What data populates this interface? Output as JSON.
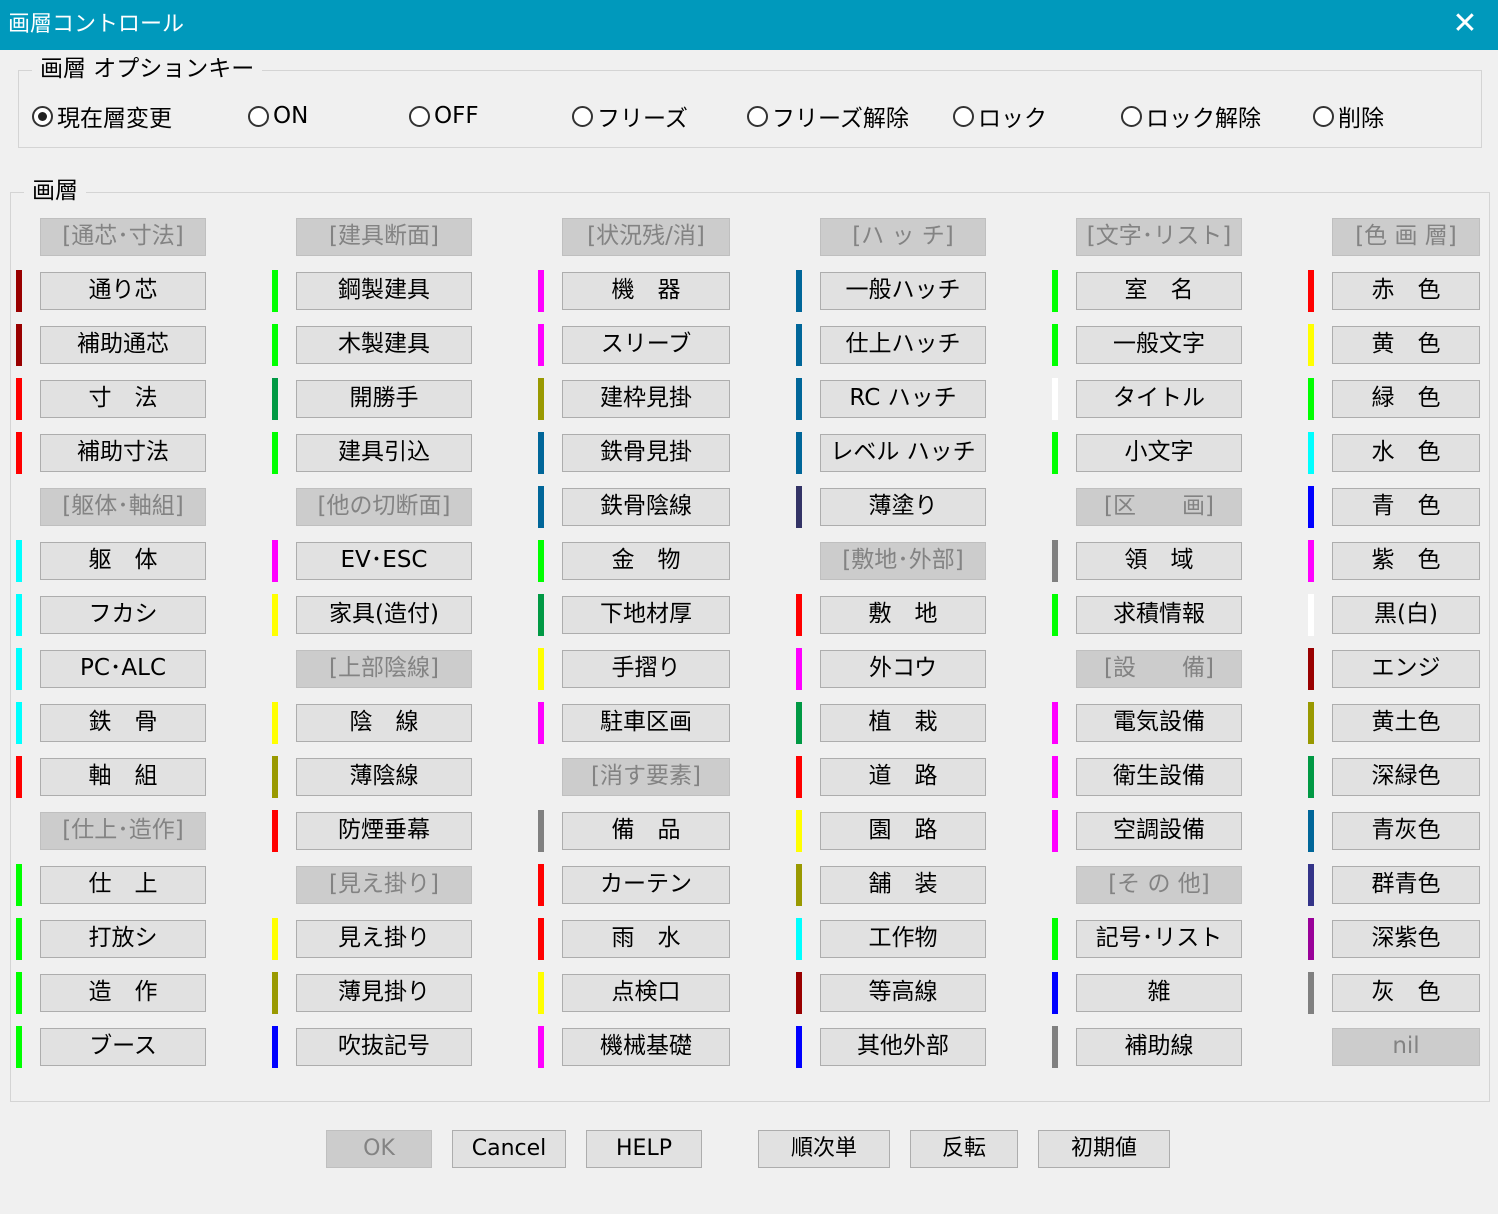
{
  "window": {
    "title": "画層コントロール",
    "close_glyph": "✕"
  },
  "options": {
    "legend": "画層 オプションキー",
    "selected": 0,
    "items": [
      "現在層変更",
      "ON",
      "OFF",
      "フリーズ",
      "フリーズ解除",
      "ロック",
      "ロック解除",
      "削除"
    ]
  },
  "layers": {
    "legend": "画層",
    "columns": [
      [
        {
          "label": "[通芯･寸法]",
          "cat": true
        },
        {
          "label": "通り芯",
          "color": "#990000"
        },
        {
          "label": "補助通芯",
          "color": "#990000"
        },
        {
          "label": "寸　法",
          "color": "#ff0000"
        },
        {
          "label": "補助寸法",
          "color": "#ff0000"
        },
        {
          "label": "[躯体･軸組]",
          "cat": true
        },
        {
          "label": "躯　体",
          "color": "#00ffff"
        },
        {
          "label": "フカシ",
          "color": "#00ffff"
        },
        {
          "label": "PC･ALC",
          "color": "#00ffff"
        },
        {
          "label": "鉄　骨",
          "color": "#00ffff"
        },
        {
          "label": "軸　組",
          "color": "#ff0000"
        },
        {
          "label": "[仕上･造作]",
          "cat": true
        },
        {
          "label": "仕　上",
          "color": "#00ff00"
        },
        {
          "label": "打放シ",
          "color": "#00ff00"
        },
        {
          "label": "造　作",
          "color": "#00ff00"
        },
        {
          "label": "ブース",
          "color": "#00ff00"
        }
      ],
      [
        {
          "label": "[建具断面]",
          "cat": true
        },
        {
          "label": "鋼製建具",
          "color": "#00ff00"
        },
        {
          "label": "木製建具",
          "color": "#00ff00"
        },
        {
          "label": "開勝手",
          "color": "#009944"
        },
        {
          "label": "建具引込",
          "color": "#00ff00"
        },
        {
          "label": "[他の切断面]",
          "cat": true
        },
        {
          "label": "EV･ESC",
          "color": "#ff00ff"
        },
        {
          "label": "家具(造付)",
          "color": "#ffff00"
        },
        {
          "label": "[上部陰線]",
          "cat": true
        },
        {
          "label": "陰　線",
          "color": "#ffff00"
        },
        {
          "label": "薄陰線",
          "color": "#999900"
        },
        {
          "label": "防煙垂幕",
          "color": "#ff0000"
        },
        {
          "label": "[見え掛り]",
          "cat": true
        },
        {
          "label": "見え掛り",
          "color": "#ffff00"
        },
        {
          "label": "薄見掛り",
          "color": "#999900"
        },
        {
          "label": "吹抜記号",
          "color": "#0000ff"
        }
      ],
      [
        {
          "label": "[状況残/消]",
          "cat": true
        },
        {
          "label": "機　器",
          "color": "#ff00ff"
        },
        {
          "label": "スリーブ",
          "color": "#ff00ff"
        },
        {
          "label": "建枠見掛",
          "color": "#999900"
        },
        {
          "label": "鉄骨見掛",
          "color": "#006699"
        },
        {
          "label": "鉄骨陰線",
          "color": "#006699"
        },
        {
          "label": "金　物",
          "color": "#00ff00"
        },
        {
          "label": "下地材厚",
          "color": "#009944"
        },
        {
          "label": "手摺り",
          "color": "#ffff00"
        },
        {
          "label": "駐車区画",
          "color": "#ff00ff"
        },
        {
          "label": "[消す要素]",
          "cat": true
        },
        {
          "label": "備　品",
          "color": "#808080"
        },
        {
          "label": "カーテン",
          "color": "#ff0000"
        },
        {
          "label": "雨　水",
          "color": "#ff0000"
        },
        {
          "label": "点検口",
          "color": "#ffff00"
        },
        {
          "label": "機械基礎",
          "color": "#ff00ff"
        }
      ],
      [
        {
          "label": "[ハ ッ チ]",
          "cat": true
        },
        {
          "label": "一般ハッチ",
          "color": "#006699"
        },
        {
          "label": "仕上ハッチ",
          "color": "#006699"
        },
        {
          "label": "RC ハッチ",
          "color": "#006699"
        },
        {
          "label": "レベル ハッチ",
          "color": "#006699"
        },
        {
          "label": "薄塗り",
          "color": "#333366"
        },
        {
          "label": "[敷地･外部]",
          "cat": true
        },
        {
          "label": "敷　地",
          "color": "#ff0000"
        },
        {
          "label": "外コウ",
          "color": "#ff00ff"
        },
        {
          "label": "植　栽",
          "color": "#009944"
        },
        {
          "label": "道　路",
          "color": "#ff0000"
        },
        {
          "label": "園　路",
          "color": "#ffff00"
        },
        {
          "label": "舗　装",
          "color": "#999900"
        },
        {
          "label": "工作物",
          "color": "#00ffff"
        },
        {
          "label": "等高線",
          "color": "#990000"
        },
        {
          "label": "其他外部",
          "color": "#0000ff"
        }
      ],
      [
        {
          "label": "[文字･リスト]",
          "cat": true
        },
        {
          "label": "室　名",
          "color": "#00ff00"
        },
        {
          "label": "一般文字",
          "color": "#00ff00"
        },
        {
          "label": "タイトル",
          "color": "#ffffff"
        },
        {
          "label": "小文字",
          "color": "#00ff00"
        },
        {
          "label": "[区　　画]",
          "cat": true
        },
        {
          "label": "領　域",
          "color": "#808080"
        },
        {
          "label": "求積情報",
          "color": "#00ff00"
        },
        {
          "label": "[設　　備]",
          "cat": true
        },
        {
          "label": "電気設備",
          "color": "#ff00ff"
        },
        {
          "label": "衛生設備",
          "color": "#ff00ff"
        },
        {
          "label": "空調設備",
          "color": "#ff00ff"
        },
        {
          "label": "[そ の 他]",
          "cat": true
        },
        {
          "label": "記号･リスト",
          "color": "#00ff00"
        },
        {
          "label": "雑",
          "color": "#0000ff"
        },
        {
          "label": "補助線",
          "color": "#808080"
        }
      ],
      [
        {
          "label": "[色 画 層]",
          "cat": true
        },
        {
          "label": "赤　色",
          "color": "#ff0000"
        },
        {
          "label": "黄　色",
          "color": "#ffff00"
        },
        {
          "label": "緑　色",
          "color": "#00ff00"
        },
        {
          "label": "水　色",
          "color": "#00ffff"
        },
        {
          "label": "青　色",
          "color": "#0000ff"
        },
        {
          "label": "紫　色",
          "color": "#ff00ff"
        },
        {
          "label": "黒(白)",
          "color": "#ffffff"
        },
        {
          "label": "エンジ",
          "color": "#990000"
        },
        {
          "label": "黄土色",
          "color": "#999900"
        },
        {
          "label": "深緑色",
          "color": "#009944"
        },
        {
          "label": "青灰色",
          "color": "#006699"
        },
        {
          "label": "群青色",
          "color": "#333388"
        },
        {
          "label": "深紫色",
          "color": "#990099"
        },
        {
          "label": "灰　色",
          "color": "#808080"
        },
        {
          "label": "nil",
          "cat": true
        }
      ]
    ]
  },
  "buttons": [
    {
      "label": "OK",
      "disabled": true
    },
    {
      "label": "Cancel"
    },
    {
      "label": "HELP"
    },
    {
      "label": "順次単"
    },
    {
      "label": "反転"
    },
    {
      "label": "初期値"
    }
  ]
}
